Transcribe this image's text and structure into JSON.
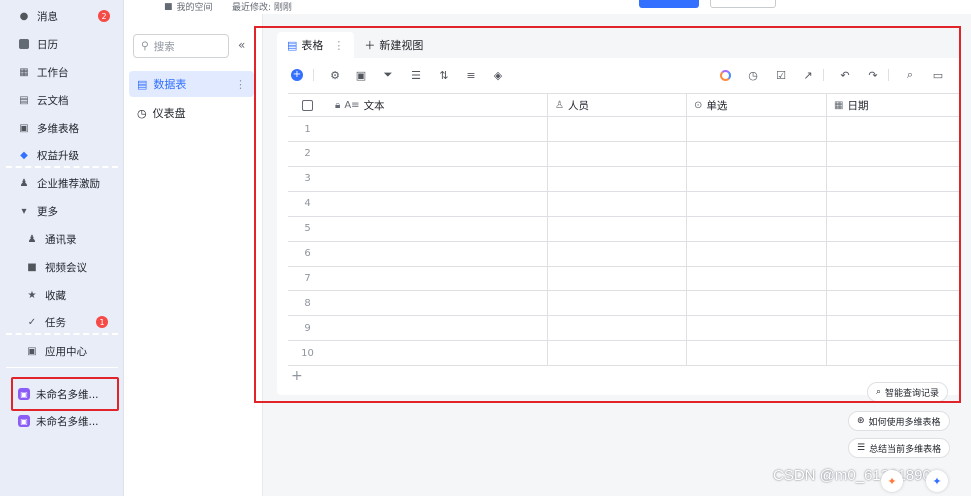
{
  "sidebar": {
    "items": [
      {
        "label": "消息",
        "badge": "2"
      },
      {
        "label": "日历"
      },
      {
        "label": "工作台"
      },
      {
        "label": "云文档"
      },
      {
        "label": "多维表格"
      },
      {
        "label": "权益升级"
      },
      {
        "label": "企业推荐激励"
      },
      {
        "label": "更多"
      },
      {
        "label": "通讯录"
      },
      {
        "label": "视频会议"
      },
      {
        "label": "收藏"
      },
      {
        "label": "任务",
        "badge": "1"
      },
      {
        "label": "应用中心"
      }
    ],
    "apps": [
      {
        "label": "未命名多维..."
      },
      {
        "label": "未命名多维..."
      }
    ]
  },
  "topbar": {
    "crumb": "我的空间",
    "modified": "最近修改: 刚刚"
  },
  "midpanel": {
    "search_placeholder": "搜索",
    "items": [
      {
        "label": "数据表"
      },
      {
        "label": "仪表盘"
      }
    ]
  },
  "view": {
    "tab_label": "表格",
    "new_view": "新建视图"
  },
  "table": {
    "columns": [
      {
        "label": "文本",
        "type_icon": "A≡"
      },
      {
        "label": "人员"
      },
      {
        "label": "单选"
      },
      {
        "label": "日期"
      }
    ],
    "rows": [
      "1",
      "2",
      "3",
      "4",
      "5",
      "6",
      "7",
      "8",
      "9",
      "10"
    ]
  },
  "assist": {
    "query": "智能查询记录",
    "howto": "如何使用多维表格",
    "summary": "总结当前多维表格"
  },
  "watermark": "CSDN @m0_61361890",
  "colors": {
    "accent": "#3370ff",
    "highlight_box": "#e0242a",
    "sidebar_bg": "#e8edf8"
  }
}
